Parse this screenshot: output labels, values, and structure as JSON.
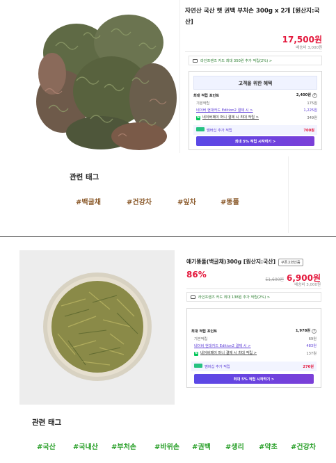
{
  "product1": {
    "title": "자연산 국산 햇 권백 부처손 300g x 2개 [원산지:국산]",
    "price": "17,500원",
    "shipping": "배송비 3,000원",
    "card_banner": "라인프렌즈 카드 최대 350원 추가 적립(2%) >",
    "benefit": {
      "heading": "고객을 위한 혜택",
      "max_points_label": "최대 적립 포인트",
      "max_points_value": "2,400원",
      "base_label": "기본적립",
      "base_value": "175원",
      "card_label": "네이버 현대카드 Edition2 결제 시 >",
      "card_value": "1,225원",
      "pay_label": "네이버페이 머니 결제 시 최대 적립 >",
      "pay_value": "349원",
      "member_label": "멤버십 추가 적립",
      "member_value": "700원",
      "join_button": "최대 5% 적립 시작하기 >"
    },
    "tags_title": "관련 태그",
    "tags": [
      "#백굴채",
      "#건강차",
      "#잎차",
      "#똥풀"
    ]
  },
  "product2": {
    "title": "애기똥풀(백굴채)300g [원산지:국산]",
    "coupon_button": "쿠폰고현인즘",
    "discount": "86%",
    "original_price": "51,600원",
    "price": "6,900원",
    "shipping": "배송비 3,000원",
    "card_banner": "라인프렌즈 카드 최대 138원 추가 적립(2%) >",
    "benefit": {
      "max_points_label": "최대 적립 포인트",
      "max_points_value": "1,978원",
      "base_label": "기본적립",
      "base_value": "69원",
      "card_label": "네이버 현대카드 Edition2 결제 시 >",
      "card_value": "483원",
      "pay_label": "네이버페이 머니 결제 시 최대 적립 >",
      "pay_value": "137원",
      "member_label": "멤버십 추가 적립",
      "member_value": "276원",
      "join_button": "최대 5% 적립 시작하기 >"
    },
    "tags_title": "관련 태그",
    "tags": [
      "#국산",
      "#국내산",
      "#부처손",
      "#바위손",
      "#권백",
      "#생리",
      "#약초",
      "#건강차"
    ]
  },
  "colors": {
    "price_red": "#e4183c",
    "accent_purple": "#5b3bd6",
    "tag_brown": "#8b5a2b",
    "tag_green": "#2aa02a",
    "naver_green": "#03c75a"
  }
}
